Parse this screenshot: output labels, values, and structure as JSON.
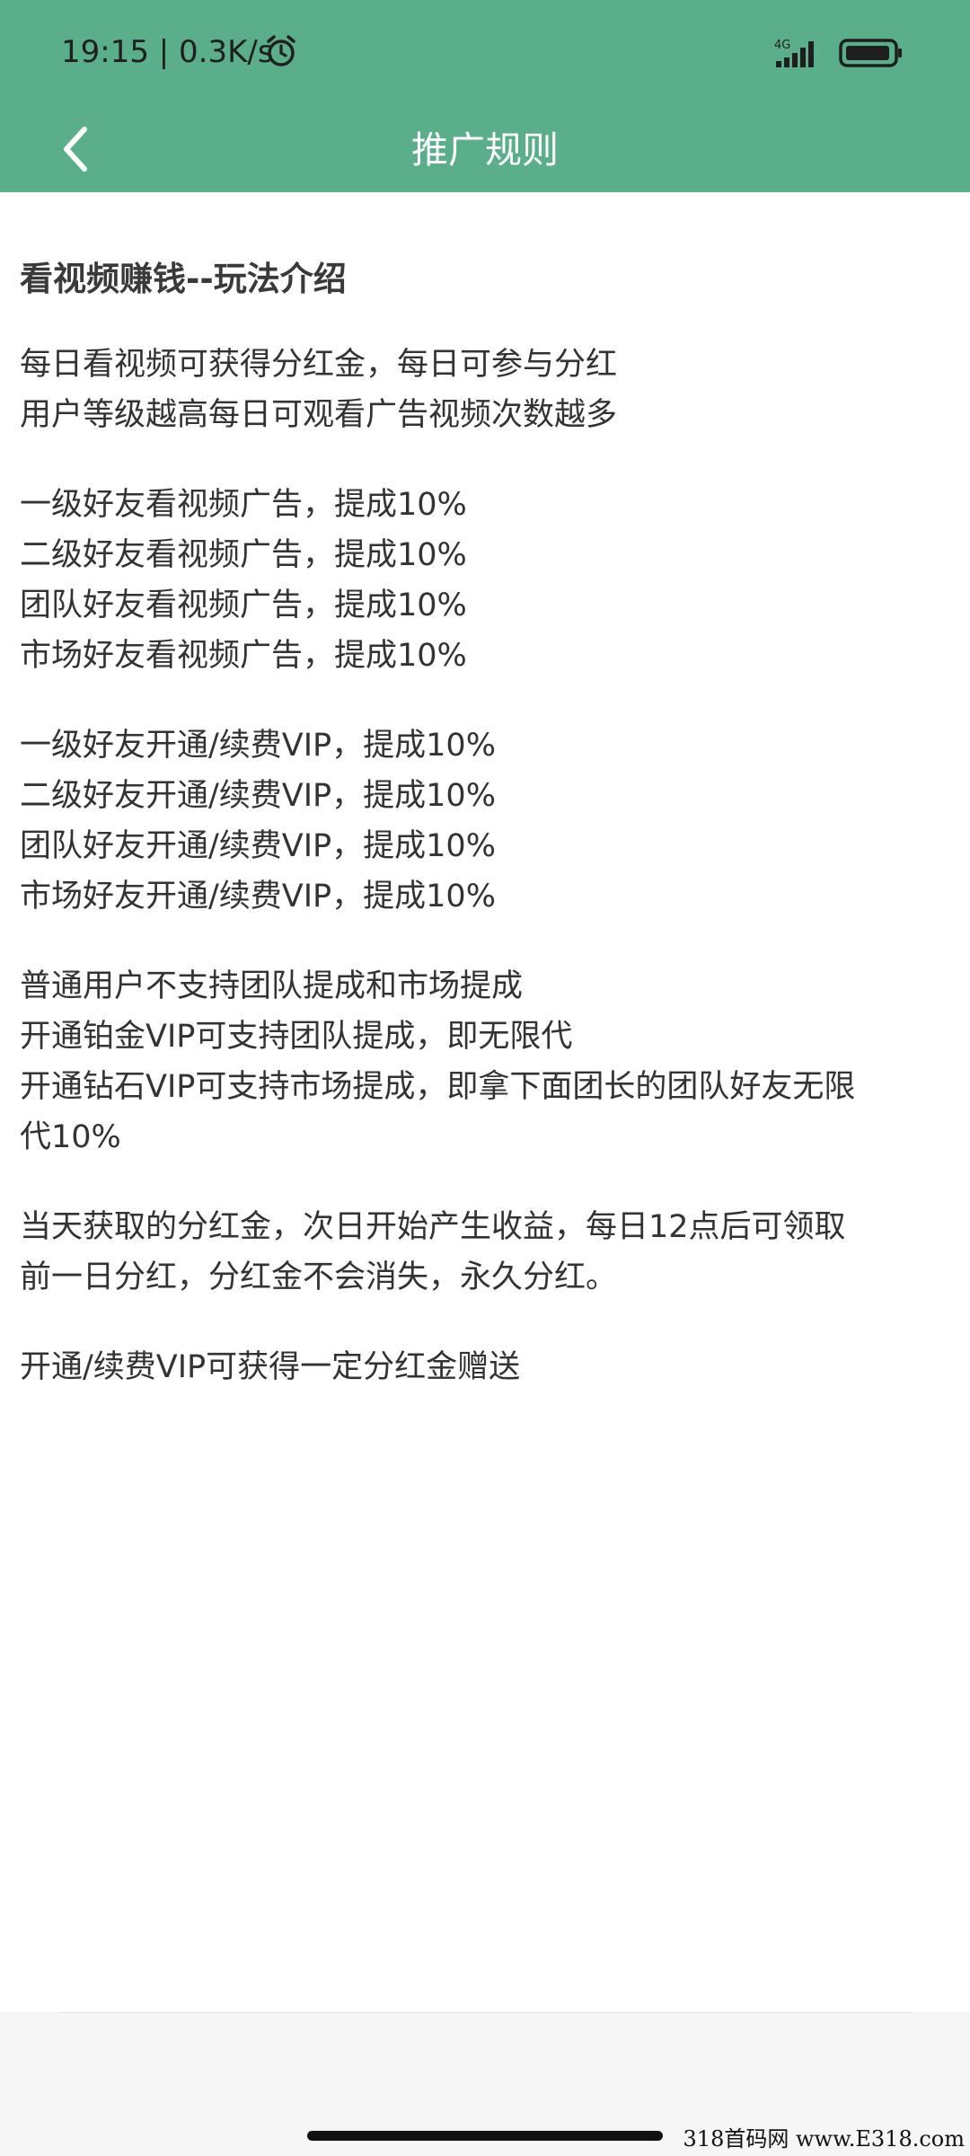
{
  "status_bar": {
    "time_speed": "19:15 | 0.3K/s",
    "network_type": "4G",
    "icons": [
      "alarm-icon",
      "signal-icon",
      "battery-icon"
    ]
  },
  "header": {
    "title": "推广规则",
    "back_icon": "chevron-left-icon",
    "background_color": "#5aae89"
  },
  "content": {
    "heading": "看视频赚钱--玩法介绍",
    "paragraphs": [
      {
        "lines": [
          "每日看视频可获得分红金，每日可参与分红",
          "用户等级越高每日可观看广告视频次数越多"
        ]
      },
      {
        "lines": [
          "一级好友看视频广告，提成10%",
          "二级好友看视频广告，提成10%",
          "团队好友看视频广告，提成10%",
          "市场好友看视频广告，提成10%"
        ]
      },
      {
        "lines": [
          "一级好友开通/续费VIP，提成10%",
          "二级好友开通/续费VIP，提成10%",
          "团队好友开通/续费VIP，提成10%",
          "市场好友开通/续费VIP，提成10%"
        ]
      },
      {
        "lines": [
          "普通用户不支持团队提成和市场提成",
          "开通铂金VIP可支持团队提成，即无限代",
          "开通钻石VIP可支持市场提成，即拿下面团长的团队好友无限",
          "代10%"
        ]
      },
      {
        "lines": [
          "当天获取的分红金，次日开始产生收益，每日12点后可领取",
          "前一日分红，分红金不会消失，永久分红。"
        ]
      },
      {
        "lines": [
          "开通/续费VIP可获得一定分红金赠送"
        ]
      }
    ]
  },
  "watermark": "318首码网  www.E318.com"
}
